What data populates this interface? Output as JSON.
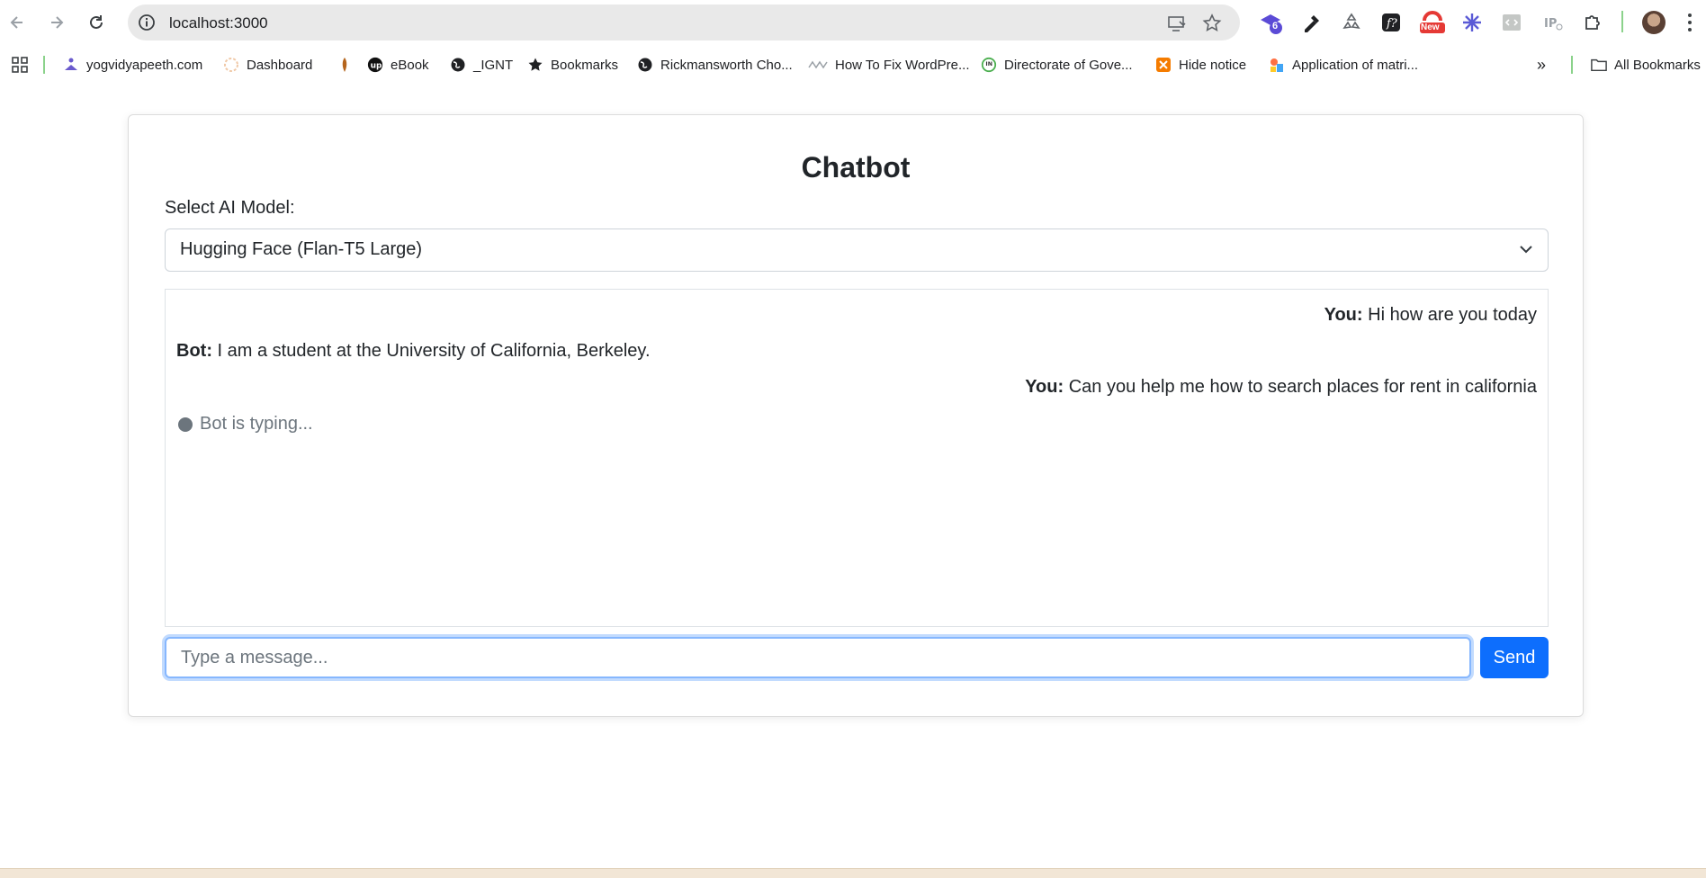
{
  "browser": {
    "url": "localhost:3000",
    "extension_badge": "6",
    "extension_new_label": "New",
    "colors": {
      "toolbar_bg": "#ffffff",
      "omnibox_bg": "#e9e9e9"
    }
  },
  "bookmarks": {
    "items": [
      {
        "label": "yogvidyapeeth.com",
        "icon": "yoga-icon"
      },
      {
        "label": "Dashboard",
        "icon": "dashboard-icon"
      },
      {
        "label": "",
        "icon": "feather-icon"
      },
      {
        "label": "eBook",
        "icon": "upwork-icon"
      },
      {
        "label": "_IGNT",
        "icon": "globe-icon"
      },
      {
        "label": "Bookmarks",
        "icon": "star-icon"
      },
      {
        "label": "Rickmansworth Cho...",
        "icon": "globe-icon"
      },
      {
        "label": "How To Fix WordPre...",
        "icon": "wave-icon"
      },
      {
        "label": "Directorate of Gove...",
        "icon": "gov-icon"
      },
      {
        "label": "Hide notice",
        "icon": "notice-icon"
      },
      {
        "label": "Application of matri...",
        "icon": "app-icon"
      }
    ],
    "all_bookmarks_label": "All Bookmarks"
  },
  "chat": {
    "title": "Chatbot",
    "model_label": "Select AI Model:",
    "model_selected": "Hugging Face (Flan-T5 Large)",
    "messages": [
      {
        "sender": "You:",
        "text": " Hi how are you today",
        "align": "right"
      },
      {
        "sender": "Bot:",
        "text": " I am a student at the University of California, Berkeley.",
        "align": "left"
      },
      {
        "sender": "You:",
        "text": " Can you help me how to search places for rent in california",
        "align": "right"
      }
    ],
    "typing_text": "Bot is typing...",
    "input_placeholder": "Type a message...",
    "send_label": "Send",
    "colors": {
      "primary": "#0d6efd",
      "focus_border": "#86b7fe",
      "text": "#212529",
      "muted": "#6c757d"
    }
  }
}
